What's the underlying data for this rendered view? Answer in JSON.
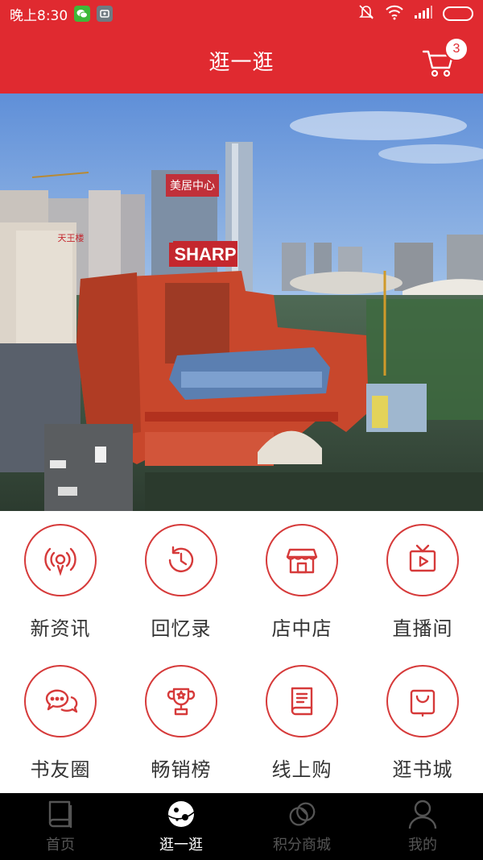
{
  "status_bar": {
    "time": "晚上8:30",
    "left_apps": [
      "wechat-icon",
      "gallery-icon"
    ],
    "right_icons": [
      "mute-icon",
      "wifi-icon",
      "signal-icon",
      "battery-icon"
    ]
  },
  "header": {
    "title": "逛一逛",
    "cart_count": "3",
    "background": "#e02a30"
  },
  "banner": {
    "building_sign": "SHARP",
    "billboard": "美居中心",
    "rooftop_sign": "天王楼"
  },
  "menu": {
    "items": [
      {
        "label": "新资讯",
        "icon": "broadcast-icon"
      },
      {
        "label": "回忆录",
        "icon": "history-icon"
      },
      {
        "label": "店中店",
        "icon": "storefront-icon"
      },
      {
        "label": "直播间",
        "icon": "tv-play-icon"
      },
      {
        "label": "书友圈",
        "icon": "chat-bubbles-icon"
      },
      {
        "label": "畅销榜",
        "icon": "trophy-icon"
      },
      {
        "label": "线上购",
        "icon": "book-icon"
      },
      {
        "label": "逛书城",
        "icon": "shopping-bag-icon"
      }
    ],
    "accent": "#d63a3a"
  },
  "bottom_nav": {
    "items": [
      {
        "label": "首页",
        "icon": "book-home-icon",
        "active": false
      },
      {
        "label": "逛一逛",
        "icon": "planet-icon",
        "active": true
      },
      {
        "label": "积分商城",
        "icon": "coins-icon",
        "active": false
      },
      {
        "label": "我的",
        "icon": "person-icon",
        "active": false
      }
    ]
  }
}
